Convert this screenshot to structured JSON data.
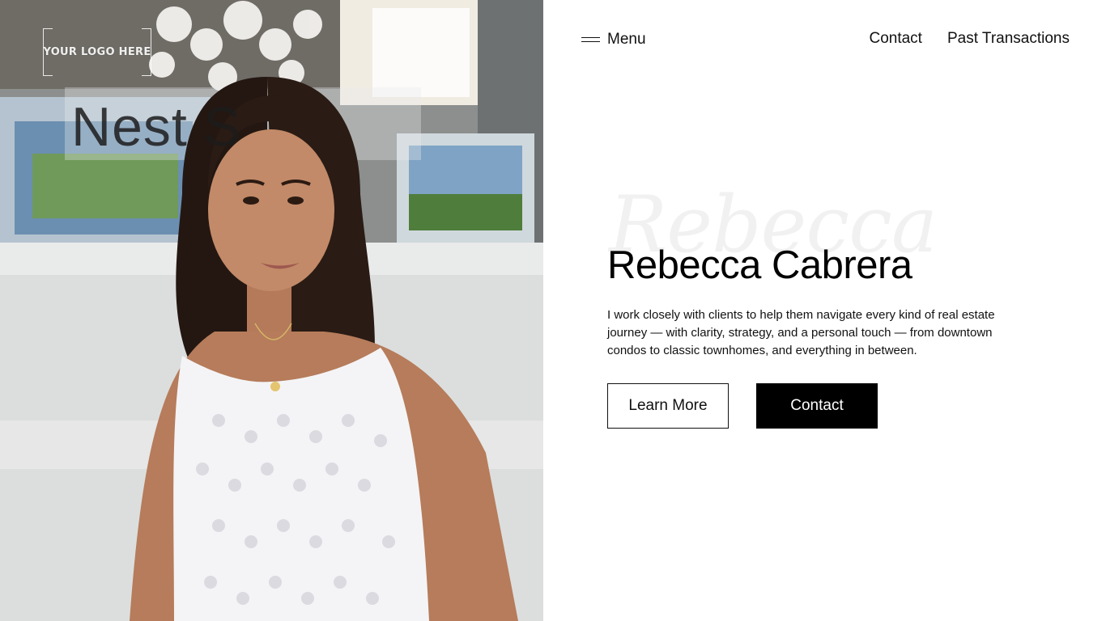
{
  "logo": {
    "text": "YOUR LOGO HERE"
  },
  "photo": {
    "storefront_sign": "Nest S"
  },
  "nav": {
    "menu_label": "Menu",
    "links": [
      "Contact",
      "Past Transactions"
    ]
  },
  "hero": {
    "script_text": "Rebecca",
    "name": "Rebecca Cabrera",
    "bio": "I work closely with clients to help them navigate every kind of real estate journey — with clarity, strategy, and a personal touch — from downtown condos to classic townhomes, and everything in between.",
    "buttons": {
      "learn_more": "Learn More",
      "contact": "Contact"
    }
  },
  "colors": {
    "background": "#ffffff",
    "text": "#000000",
    "button_solid": "#000000",
    "button_solid_text": "#ffffff"
  }
}
